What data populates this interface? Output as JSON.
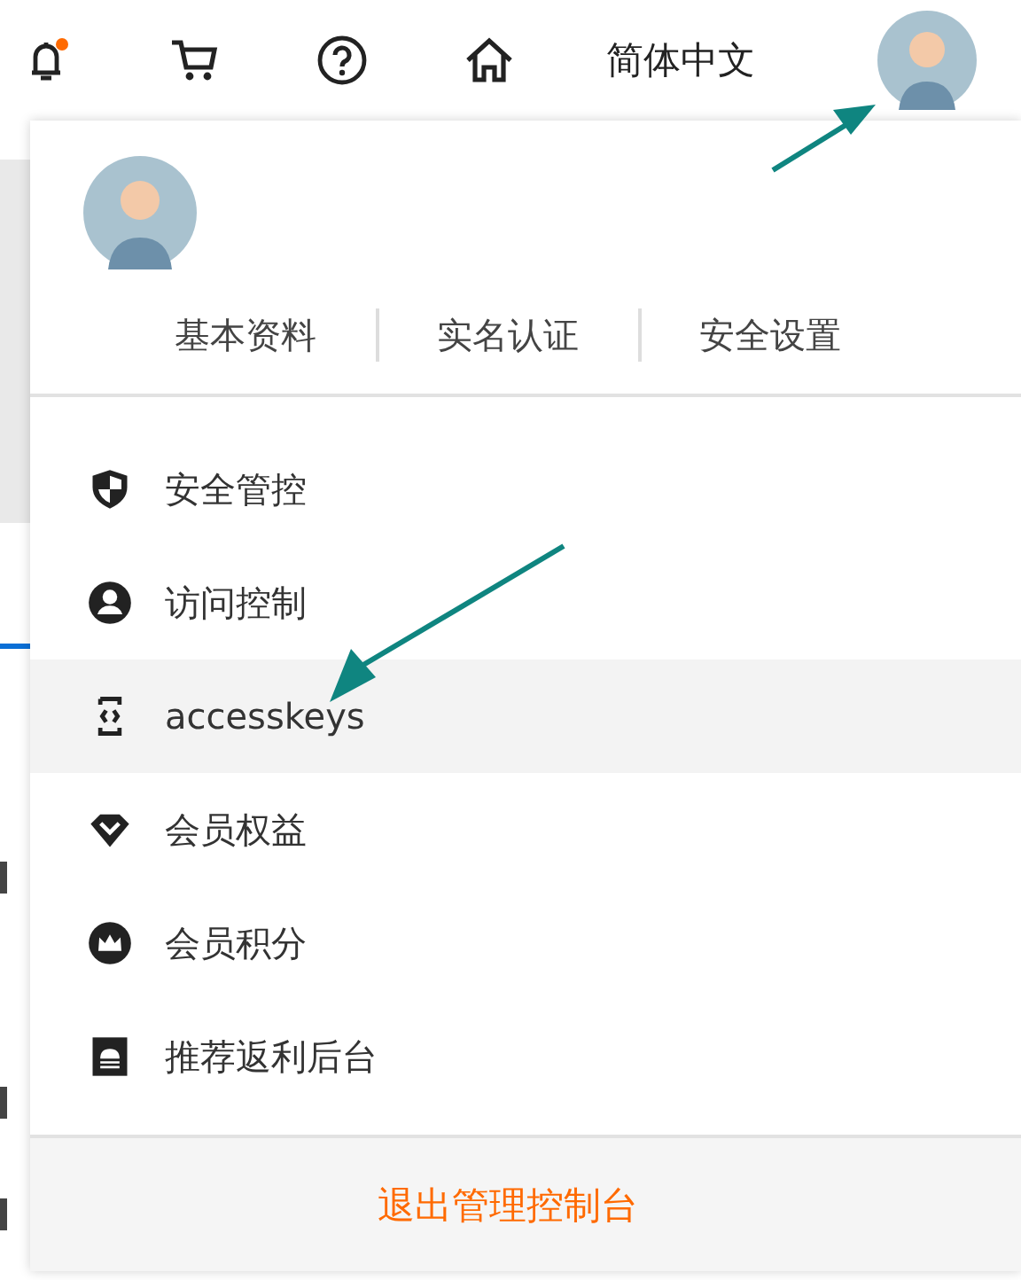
{
  "top_bar": {
    "language": "简体中文"
  },
  "dropdown": {
    "links": [
      "基本资料",
      "实名认证",
      "安全设置"
    ],
    "items": [
      {
        "kind": "shield",
        "label": "安全管控",
        "selected": false
      },
      {
        "kind": "user",
        "label": "访问控制",
        "selected": false
      },
      {
        "kind": "key",
        "label": "accesskeys",
        "selected": true
      },
      {
        "kind": "diamond",
        "label": "会员权益",
        "selected": false
      },
      {
        "kind": "crown",
        "label": "会员积分",
        "selected": false
      },
      {
        "kind": "board",
        "label": "推荐返利后台",
        "selected": false
      }
    ],
    "logout": "退出管理控制台"
  }
}
